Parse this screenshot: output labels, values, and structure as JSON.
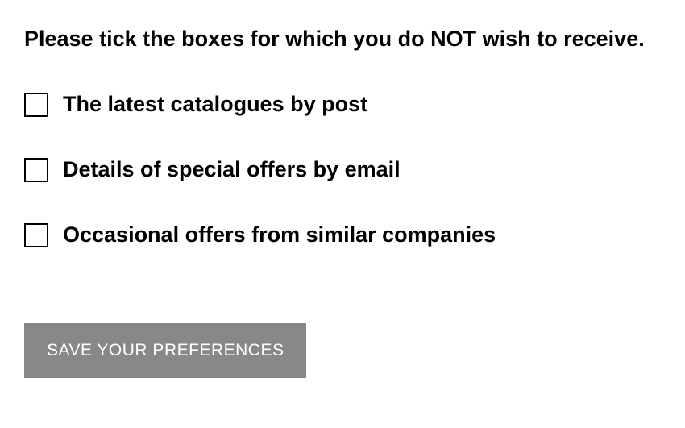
{
  "heading": "Please tick the boxes for which you do NOT wish to receive.",
  "options": [
    {
      "label": "The latest catalogues by post"
    },
    {
      "label": "Details of special offers by email"
    },
    {
      "label": "Occasional offers from similar companies"
    }
  ],
  "button": {
    "save_label": "SAVE YOUR PREFERENCES"
  }
}
